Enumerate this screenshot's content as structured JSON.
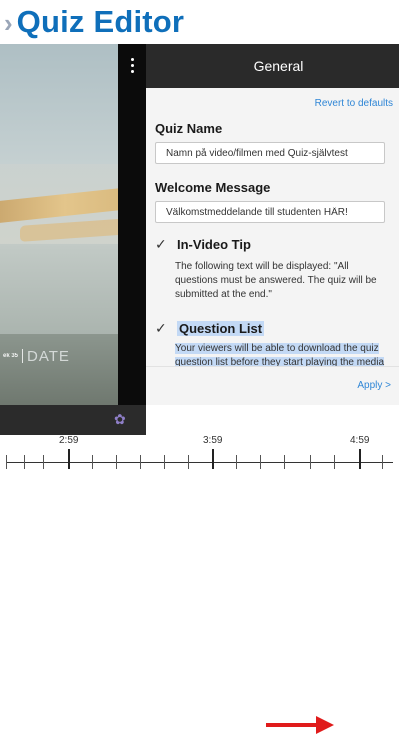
{
  "header": {
    "title": "Quiz Editor"
  },
  "video": {
    "date_small": "ek 35",
    "date_big": "DATE"
  },
  "panel": {
    "title": "General",
    "revert_label": "Revert to defaults",
    "quiz_name": {
      "label": "Quiz Name",
      "value": "Namn på video/filmen med Quiz-självtest"
    },
    "welcome": {
      "label": "Welcome Message",
      "value": "Välkomstmeddelande till studenten HÄR!"
    },
    "in_video_tip": {
      "label": "In-Video Tip",
      "checked": true,
      "description": "The following text will be displayed: \"All questions must be answered. The quiz will be submitted at the end.\""
    },
    "question_list": {
      "label": "Question List",
      "checked": true,
      "description": "Your viewers will be able to download the quiz question list before they start playing the media"
    },
    "apply_label": "Apply >"
  },
  "timeline": {
    "labels": [
      "2:59",
      "3:59",
      "4:59"
    ]
  },
  "colors": {
    "title_blue": "#0f6fba",
    "link_blue": "#2f86d6",
    "arrow_red": "#e01b1b",
    "highlight": "#c3d9f5"
  },
  "icons": {
    "chevron": "chevron-right-icon",
    "kebab": "kebab-menu-icon",
    "check": "checkmark-icon",
    "gear": "gear-icon",
    "arrow": "arrow-right-icon"
  }
}
